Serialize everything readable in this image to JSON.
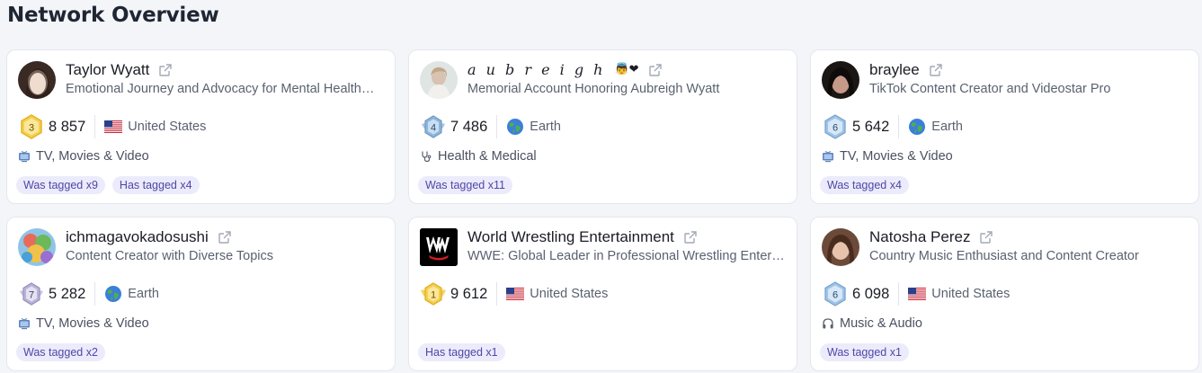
{
  "page_title": "Network Overview",
  "colors": {
    "background": "#f3f5f9",
    "card": "#ffffff",
    "tag_bg": "#ecebfb",
    "tag_text": "#4d47a8",
    "muted_text": "#5a6170"
  },
  "cards": [
    {
      "name": "Taylor Wyatt",
      "description": "Emotional Journey and Advocacy for Mental Health…",
      "rank": "3",
      "followers": "8 857",
      "location": "United States",
      "location_icon": "us-flag-icon",
      "category": "TV, Movies & Video",
      "category_icon": "tv-icon",
      "tags": [
        "Was tagged x9",
        "Has tagged x4"
      ]
    },
    {
      "name": "a u b r e i g h",
      "name_emoji": "👼❤",
      "description": "Memorial Account Honoring Aubreigh Wyatt",
      "rank": "4",
      "followers": "7 486",
      "location": "Earth",
      "location_icon": "globe-icon",
      "category": "Health & Medical",
      "category_icon": "stethoscope-icon",
      "tags": [
        "Was tagged x11"
      ]
    },
    {
      "name": "braylee",
      "description": "TikTok Content Creator and Videostar Pro",
      "rank": "6",
      "followers": "5 642",
      "location": "Earth",
      "location_icon": "globe-icon",
      "category": "TV, Movies & Video",
      "category_icon": "tv-icon",
      "tags": [
        "Was tagged x4"
      ]
    },
    {
      "name": "ichmagavokadosushi",
      "description": "Content Creator with Diverse Topics",
      "rank": "7",
      "followers": "5 282",
      "location": "Earth",
      "location_icon": "globe-icon",
      "category": "TV, Movies & Video",
      "category_icon": "tv-icon",
      "tags": [
        "Was tagged x2"
      ]
    },
    {
      "name": "World Wrestling Entertainment",
      "description": "WWE: Global Leader in Professional Wrestling Entert…",
      "rank": "1",
      "followers": "9 612",
      "location": "United States",
      "location_icon": "us-flag-icon",
      "category": "",
      "category_icon": "",
      "tags": [
        "Has tagged x1"
      ]
    },
    {
      "name": "Natosha Perez",
      "description": "Country Music Enthusiast and Content Creator",
      "rank": "6",
      "followers": "6 098",
      "location": "United States",
      "location_icon": "us-flag-icon",
      "category": "Music & Audio",
      "category_icon": "headphones-icon",
      "tags": [
        "Was tagged x1"
      ]
    }
  ]
}
